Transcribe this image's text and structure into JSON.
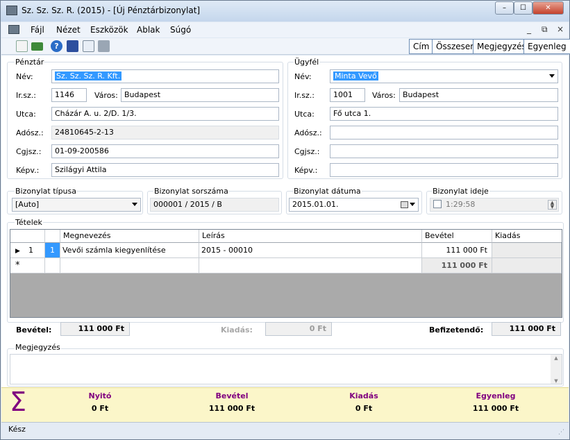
{
  "window": {
    "title": "Sz. Sz. Sz. R. (2015) - [Új Pénztárbizonylat]",
    "minimize": "–",
    "maximize": "☐",
    "close": "✕"
  },
  "menu": {
    "items": [
      "Fájl",
      "Nézet",
      "Eszközök",
      "Ablak",
      "Súgó"
    ],
    "mdi_minimize": "_",
    "mdi_restore": "⧉",
    "mdi_close": "×"
  },
  "toolbar": {
    "icons": [
      "new-document-icon",
      "money-icon",
      "help-icon",
      "save-icon",
      "print-preview-icon",
      "print-icon"
    ],
    "right_buttons": [
      "Cím",
      "Összesen",
      "Megjegyzés",
      "Egyenleg"
    ]
  },
  "penztar": {
    "group_label": "Pénztár",
    "nev_label": "Név:",
    "nev": "Sz. Sz. Sz. R. Kft.",
    "irsz_label": "Ir.sz.:",
    "irsz": "1146",
    "varos_label": "Város:",
    "varos": "Budapest",
    "utca_label": "Utca:",
    "utca": "Cházár A. u. 2/D. 1/3.",
    "adosz_label": "Adósz.:",
    "adosz": "24810645-2-13",
    "cgjsz_label": "Cgjsz.:",
    "cgjsz": "01-09-200586",
    "kepv_label": "Képv.:",
    "kepv": "Szilágyi Attila"
  },
  "ugyfel": {
    "group_label": "Ügyfél",
    "nev_label": "Név:",
    "nev": "Minta Vevő",
    "irsz_label": "Ir.sz.:",
    "irsz": "1001",
    "varos_label": "Város:",
    "varos": "Budapest",
    "utca_label": "Utca:",
    "utca": "Fő utca 1.",
    "adosz_label": "Adósz.:",
    "adosz": "",
    "cgjsz_label": "Cgjsz.:",
    "cgjsz": "",
    "kepv_label": "Képv.:",
    "kepv": ""
  },
  "bizonylat": {
    "tipus_label": "Bizonylat típusa",
    "tipus": "[Auto]",
    "sorszam_label": "Bizonylat sorszáma",
    "sorszam": "000001 / 2015 / B",
    "datum_label": "Bizonylat dátuma",
    "datum": "2015.01.01.",
    "ido_label": "Bizonylat ideje",
    "ido": "1:29:58"
  },
  "tetelek": {
    "label": "Tételek",
    "columns": [
      "Megnevezés",
      "Leírás",
      "Bevétel",
      "Kiadás"
    ],
    "rows": [
      {
        "row_no": "1",
        "index": "1",
        "megnevezes": "Vevői számla kiegyenlítése",
        "leiras": "2015 - 00010",
        "bevetel": "111 000 Ft",
        "kiadas": ""
      }
    ],
    "new_row_marker": "*",
    "total_bevetel": "111 000 Ft"
  },
  "totals": {
    "bevetel_label": "Bevétel:",
    "bevetel": "111 000 Ft",
    "kiadas_label": "Kiadás:",
    "kiadas": "0 Ft",
    "befizetendo_label": "Befizetendő:",
    "befizetendo": "111 000 Ft"
  },
  "megjegyzes": {
    "label": "Megjegyzés",
    "value": ""
  },
  "footer": {
    "sigma": "Σ",
    "nyito_label": "Nyitó",
    "nyito": "0 Ft",
    "bevetel_label": "Bevétel",
    "bevetel": "111 000 Ft",
    "kiadas_label": "Kiadás",
    "kiadas": "0 Ft",
    "egyenleg_label": "Egyenleg",
    "egyenleg": "111 000 Ft",
    "label_color": "#800080",
    "background": "#fbf6c9"
  },
  "status": {
    "text": "Kész"
  }
}
